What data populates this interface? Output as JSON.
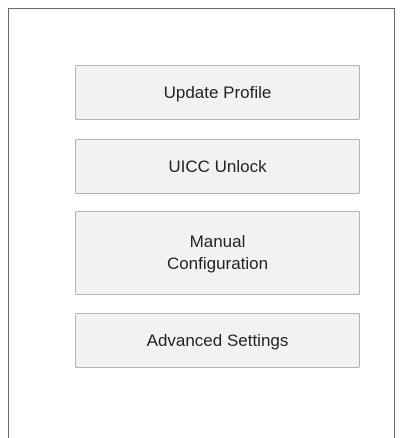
{
  "menu": {
    "buttons": [
      {
        "label": "Update Profile"
      },
      {
        "label": "UICC Unlock"
      },
      {
        "label": "Manual\nConfiguration"
      },
      {
        "label": "Advanced Settings"
      }
    ]
  }
}
